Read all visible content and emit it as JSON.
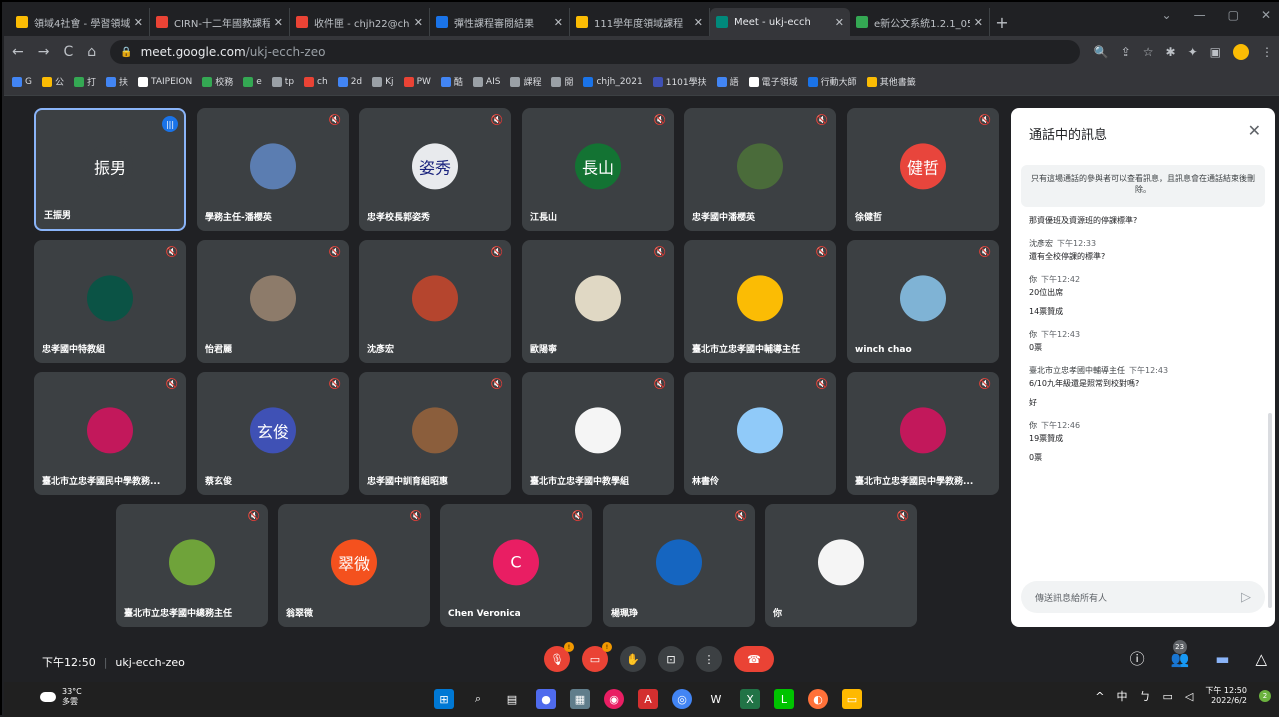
{
  "browser": {
    "tabs": [
      {
        "title": "領域4社會 - 學習領域",
        "fav_color": "#fbbc04",
        "active": false
      },
      {
        "title": "CIRN-十二年國教課程",
        "fav_color": "#ea4335",
        "active": false
      },
      {
        "title": "收件匣 - chjh22@ch",
        "fav_color": "#ea4335",
        "active": false
      },
      {
        "title": "彈性課程審閱結果",
        "fav_color": "#1a73e8",
        "active": false
      },
      {
        "title": "111學年度領域課程",
        "fav_color": "#fbbc04",
        "active": false
      },
      {
        "title": "Meet - ukj-ecch",
        "fav_color": "#00897b",
        "active": true
      },
      {
        "title": "e新公文系統1.2.1_05",
        "fav_color": "#34a853",
        "active": false
      }
    ],
    "new_tab_label": "+",
    "url_host": "meet.google.com",
    "url_path": "/ukj-ecch-zeo",
    "bookmarks": [
      {
        "label": "G",
        "color": "#4285f4"
      },
      {
        "label": "公",
        "color": "#fbbc04"
      },
      {
        "label": "打",
        "color": "#34a853"
      },
      {
        "label": "扶",
        "color": "#4285f4"
      },
      {
        "label": "TAIPEION",
        "color": "#fff"
      },
      {
        "label": "校務",
        "color": "#34a853"
      },
      {
        "label": "e",
        "color": "#34a853"
      },
      {
        "label": "tp",
        "color": "#9aa0a6"
      },
      {
        "label": "ch",
        "color": "#ea4335"
      },
      {
        "label": "2d",
        "color": "#4285f4"
      },
      {
        "label": "Kj",
        "color": "#9aa0a6"
      },
      {
        "label": "PW",
        "color": "#ea4335"
      },
      {
        "label": "酷",
        "color": "#4285f4"
      },
      {
        "label": "AIS",
        "color": "#9aa0a6"
      },
      {
        "label": "課程",
        "color": "#9aa0a6"
      },
      {
        "label": "閱",
        "color": "#9aa0a6"
      },
      {
        "label": "chjh_2021",
        "color": "#1a73e8"
      },
      {
        "label": "1101學扶",
        "color": "#3f51b5"
      },
      {
        "label": "語",
        "color": "#4285f4"
      },
      {
        "label": "電子領域",
        "color": "#fff"
      },
      {
        "label": "行動大師",
        "color": "#1a73e8"
      },
      {
        "label": "其他書籤",
        "color": "#fbbc04"
      }
    ]
  },
  "participants": [
    {
      "name": "王振男",
      "avatar_text": "振男",
      "avatar_color": "#3c4043",
      "speaking": true
    },
    {
      "name": "學務主任-潘櫻英",
      "avatar_text": "",
      "avatar_color": "#5b7db1"
    },
    {
      "name": "忠孝校長郭姿秀",
      "avatar_text": "姿秀",
      "avatar_color": "#e8eaed"
    },
    {
      "name": "江長山",
      "avatar_text": "長山",
      "avatar_color": "#137333"
    },
    {
      "name": "忠孝國中潘櫻英",
      "avatar_text": "",
      "avatar_color": "#4a6b3a"
    },
    {
      "name": "徐健哲",
      "avatar_text": "健哲",
      "avatar_color": "#e8453c"
    },
    {
      "name": "忠孝國中特教組",
      "avatar_text": "",
      "avatar_color": "#0b5345"
    },
    {
      "name": "怡君麗",
      "avatar_text": "",
      "avatar_color": "#8d7b6a"
    },
    {
      "name": "沈彥宏",
      "avatar_text": "",
      "avatar_color": "#b5452e"
    },
    {
      "name": "歐陽寧",
      "avatar_text": "",
      "avatar_color": "#e0d8c4"
    },
    {
      "name": "臺北市立忠孝國中輔導主任",
      "avatar_text": "",
      "avatar_color": "#fbbc04"
    },
    {
      "name": "winch chao",
      "avatar_text": "",
      "avatar_color": "#7fb3d5"
    },
    {
      "name": "臺北市立忠孝國民中學教務...",
      "avatar_text": "",
      "avatar_color": "#c2185b"
    },
    {
      "name": "蔡玄俊",
      "avatar_text": "玄俊",
      "avatar_color": "#3f51b5"
    },
    {
      "name": "忠孝國中訓育組昭惠",
      "avatar_text": "",
      "avatar_color": "#8b5e3c"
    },
    {
      "name": "臺北市立忠孝國中教學組",
      "avatar_text": "",
      "avatar_color": "#f5f5f5"
    },
    {
      "name": "林書伶",
      "avatar_text": "",
      "avatar_color": "#90caf9"
    },
    {
      "name": "臺北市立忠孝國民中學教務...",
      "avatar_text": "",
      "avatar_color": "#c2185b"
    },
    {
      "name": "臺北市立忠孝國中總務主任",
      "avatar_text": "",
      "avatar_color": "#6fa33a"
    },
    {
      "name": "翁翠微",
      "avatar_text": "翠微",
      "avatar_color": "#f4511e"
    },
    {
      "name": "Chen Veronica",
      "avatar_text": "C",
      "avatar_color": "#e91e63"
    },
    {
      "name": "楊珮琤",
      "avatar_text": "",
      "avatar_color": "#1565c0"
    },
    {
      "name": "你",
      "avatar_text": "",
      "avatar_color": "#f5f5f5"
    }
  ],
  "chat": {
    "title": "通話中的訊息",
    "notice": "只有這場通話的參與者可以查看訊息，且訊息會在通話結束後刪除。",
    "messages": [
      {
        "sender": "",
        "time": "",
        "lines": [
          "那資優班及資源班的停課標準?"
        ]
      },
      {
        "sender": "沈彥宏",
        "time": "下午12:33",
        "lines": [
          "還有全校停課的標準?"
        ]
      },
      {
        "sender": "你",
        "time": "下午12:42",
        "lines": [
          "20位出席",
          "14票贊成"
        ]
      },
      {
        "sender": "你",
        "time": "下午12:43",
        "lines": [
          "0票"
        ]
      },
      {
        "sender": "臺北市立忠孝國中輔導主任",
        "time": "下午12:43",
        "lines": [
          "6/10九年級還是照常到校對嗎?",
          "好"
        ]
      },
      {
        "sender": "你",
        "time": "下午12:46",
        "lines": [
          "19票贊成",
          "0票"
        ]
      }
    ],
    "input_placeholder": "傳送訊息給所有人"
  },
  "meeting": {
    "time": "下午12:50",
    "code": "ukj-ecch-zeo",
    "people_count": "23"
  },
  "taskbar": {
    "temp": "33°C",
    "weather": "多雲",
    "clock_time": "下午 12:50",
    "clock_date": "2022/6/2",
    "ime": "中",
    "notif_count": "2"
  }
}
